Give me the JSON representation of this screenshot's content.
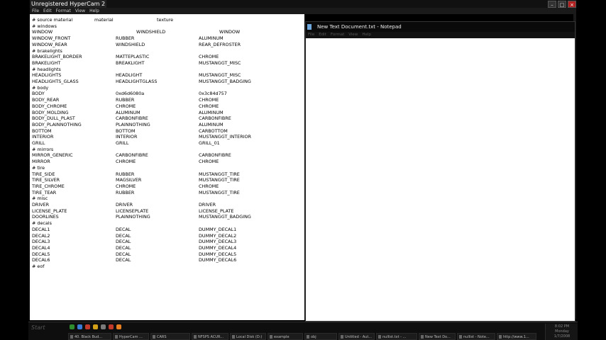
{
  "watermark": "Unregistered HyperCam 2",
  "main_menu": [
    "File",
    "Edit",
    "Format",
    "View",
    "Help"
  ],
  "window_controls": {
    "minimize": "–",
    "maximize": "□",
    "close": "×"
  },
  "editor_lines": [
    [
      "# source material",
      "material",
      "texture"
    ],
    [
      "# windows",
      "",
      ""
    ],
    [
      "WINDOW",
      "WINDSHIELD",
      "WINDOW"
    ],
    [
      "WINDOW_FRONT",
      "RUBBER",
      "ALUMINUM"
    ],
    [
      "WINDOW_REAR",
      "WINDSHIELD",
      "REAR_DEFROSTER"
    ],
    [
      "# brakelights",
      "",
      ""
    ],
    [
      "BRAKELIGHT_BORDER",
      "MATTEPLASTIC",
      "CHROME"
    ],
    [
      "BRAKELIGHT",
      "BREAKLIGHT",
      "MUSTANGGT_MISC"
    ],
    [
      "# headlights",
      "",
      ""
    ],
    [
      "HEADLIGHTS",
      "HEADLIGHT",
      "MUSTANGGT_MISC"
    ],
    [
      "HEADLIGHTS_GLASS",
      "HEADLIGHTGLASS",
      "MUSTANGGT_BADGING"
    ],
    [
      "# body",
      "",
      ""
    ],
    [
      "BODY",
      "0xd6d6080a",
      "0x3c84d757"
    ],
    [
      "BODY_REAR",
      "RUBBER",
      "CHROME"
    ],
    [
      "BODY_CHROME",
      "CHROME",
      "CHROME"
    ],
    [
      "BODY_MOLDING",
      "ALUMINUM",
      "ALUMINUM"
    ],
    [
      "BODY_DULL_PLAST",
      "CARBONFIBRE",
      "CARBONFIBRE"
    ],
    [
      "BODY_PLAINNOTHING",
      "PLAINNOTHING",
      "ALUMINUM"
    ],
    [
      "BOTTOM",
      "BOTTOM",
      "CARBOTTOM"
    ],
    [
      "INTERIOR",
      "INTERIOR",
      "MUSTANGGT_INTERIOR"
    ],
    [
      "GRILL",
      "GRILL",
      "GRILL_01"
    ],
    [
      "# mirrors",
      "",
      ""
    ],
    [
      "MIRROR_GENERIC",
      "CARBONFIBRE",
      "CARBONFIBRE"
    ],
    [
      "MIRROR",
      "CHROME",
      "CHROME"
    ],
    [
      "# tire",
      "",
      ""
    ],
    [
      "TIRE_SIDE",
      "RUBBER",
      "MUSTANGGT_TIRE"
    ],
    [
      "TIRE_SILVER",
      "MAGSILVER",
      "MUSTANGGT_TIRE"
    ],
    [
      "TIRE_CHROME",
      "CHROME",
      "CHROME"
    ],
    [
      "TIRE_TEAR",
      "RUBBER",
      "MUSTANGGT_TIRE"
    ],
    [
      "# misc",
      "",
      ""
    ],
    [
      "DRIVER",
      "DRIVER",
      "DRIVER"
    ],
    [
      "LICENSE_PLATE",
      "LICENSEPLATE",
      "LICENSE_PLATE"
    ],
    [
      "DOORLINES",
      "PLAINNOTHING",
      "MUSTANGGT_BADGING"
    ],
    [
      "# decals",
      "",
      ""
    ],
    [
      "DECAL1",
      "DECAL",
      "DUMMY_DECAL1"
    ],
    [
      "DECAL2",
      "DECAL",
      "DUMMY_DECAL2"
    ],
    [
      "DECAL3",
      "DECAL",
      "DUMMY_DECAL3"
    ],
    [
      "DECAL4",
      "DECAL",
      "DUMMY_DECAL4"
    ],
    [
      "DECAL5",
      "DECAL",
      "DUMMY_DECAL5"
    ],
    [
      "DECAL6",
      "DECAL",
      "DUMMY_DECAL6"
    ],
    [
      "# eof",
      "",
      ""
    ]
  ],
  "notepad": {
    "title": "New Text Document.txt - Notepad",
    "menu": [
      "File",
      "Edit",
      "Format",
      "View",
      "Help"
    ],
    "content": ""
  },
  "taskbar": {
    "start_label": "Start",
    "quick_launch_colors": [
      "#2e8b2e",
      "#3a7bd5",
      "#c0392b",
      "#d4a017",
      "#7b7b7b",
      "#c0392b",
      "#e67e22"
    ],
    "tasks": [
      "40. Black Bud...",
      "HyperCam ...",
      "CARS",
      "NFSPS ACUR...",
      "Local Disk (D:)",
      "example",
      "obj",
      "Untitled - Aut...",
      "nullist.txt - ...",
      "New Text Do...",
      "nullist - Note...",
      "http://www.1..."
    ],
    "clock": [
      "8:02 PM",
      "Monday",
      "1/7/2008"
    ]
  }
}
